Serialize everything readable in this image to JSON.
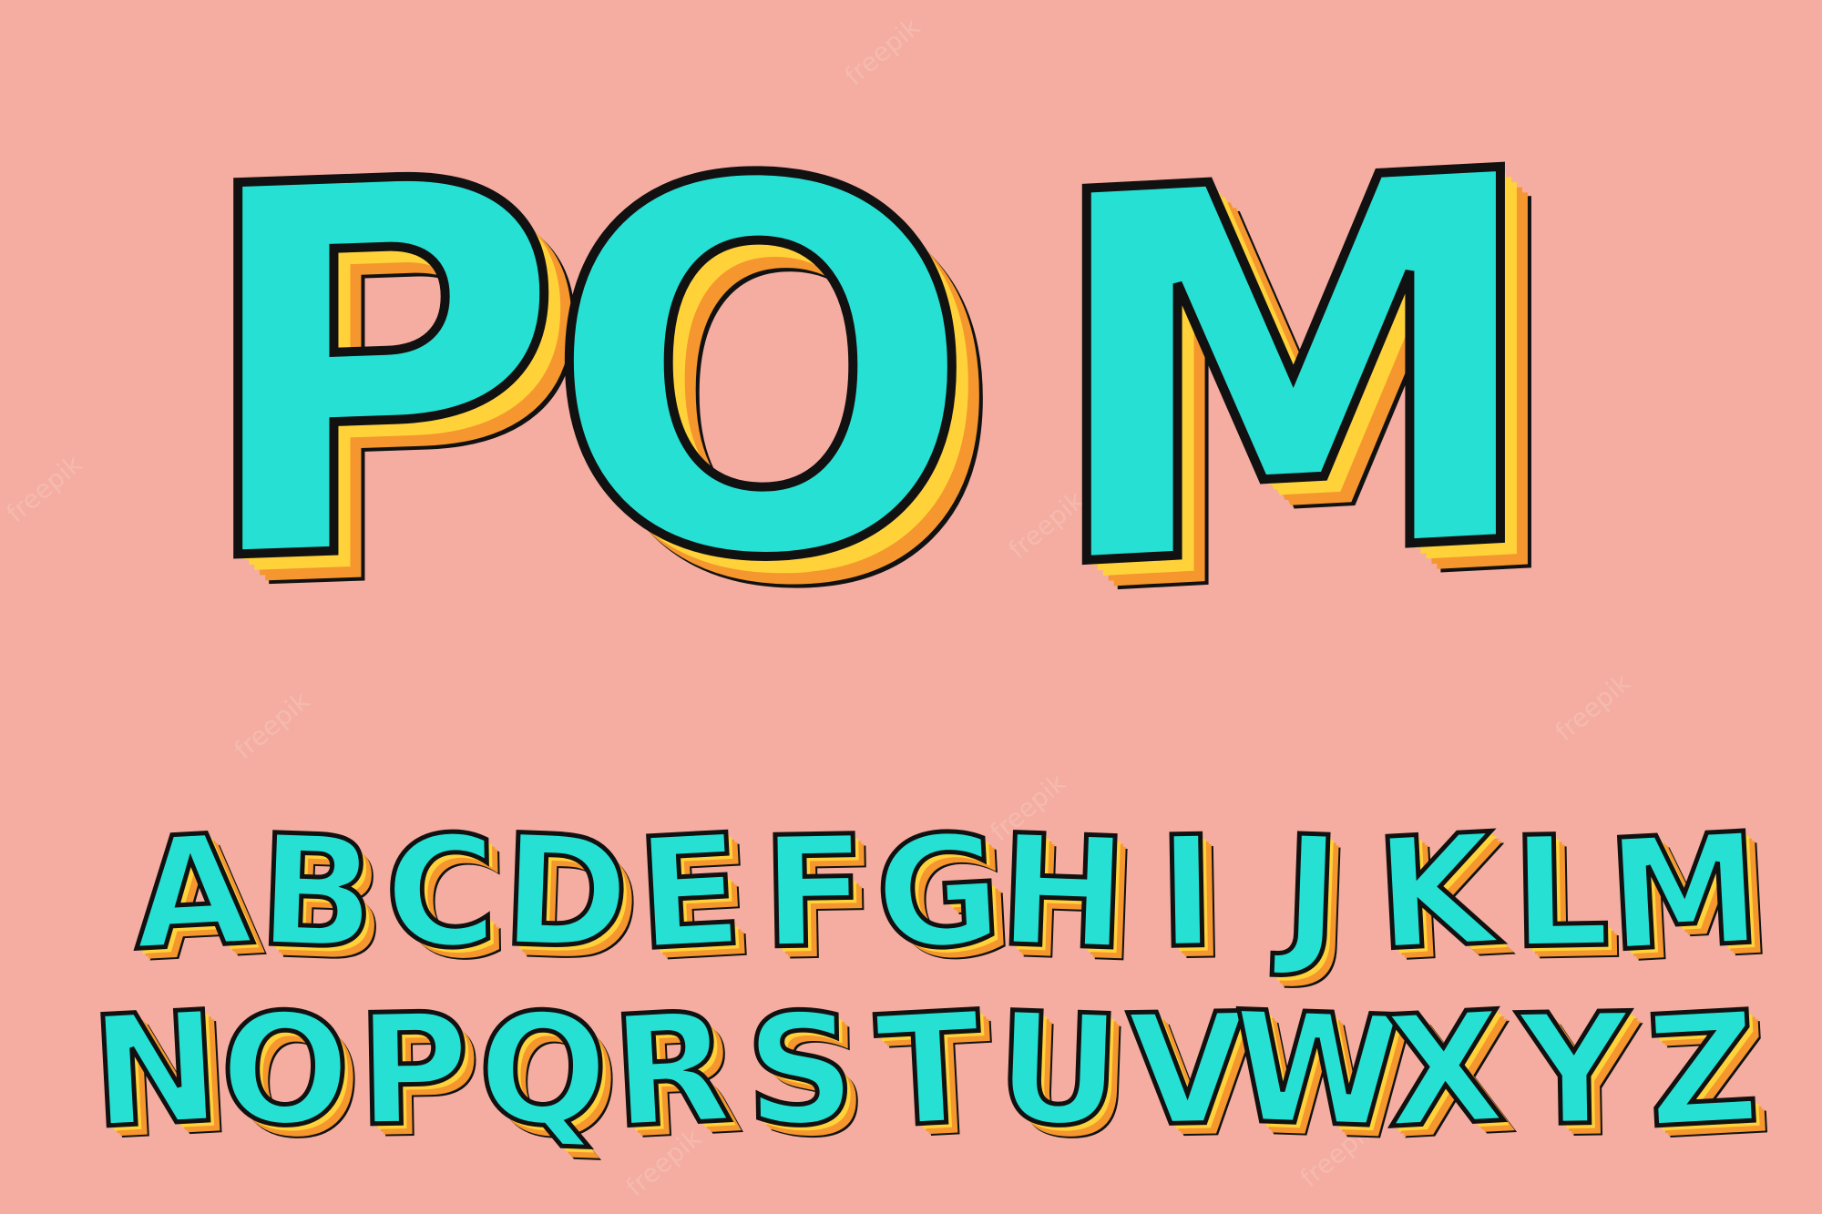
{
  "colors": {
    "background": "#F4ADA0",
    "face": "#26E0D4",
    "side_light": "#FFD23A",
    "side_dark": "#F5962E",
    "outline": "#111111"
  },
  "hero": {
    "letters": [
      "P",
      "O",
      "M"
    ]
  },
  "alphabet": {
    "row1": [
      "A",
      "B",
      "C",
      "D",
      "E",
      "F",
      "G",
      "H",
      "I",
      "J",
      "K",
      "L",
      "M"
    ],
    "row2": [
      "N",
      "O",
      "P",
      "Q",
      "R",
      "S",
      "T",
      "U",
      "V",
      "W",
      "X",
      "Y",
      "Z"
    ]
  },
  "watermark_text": "freepik"
}
